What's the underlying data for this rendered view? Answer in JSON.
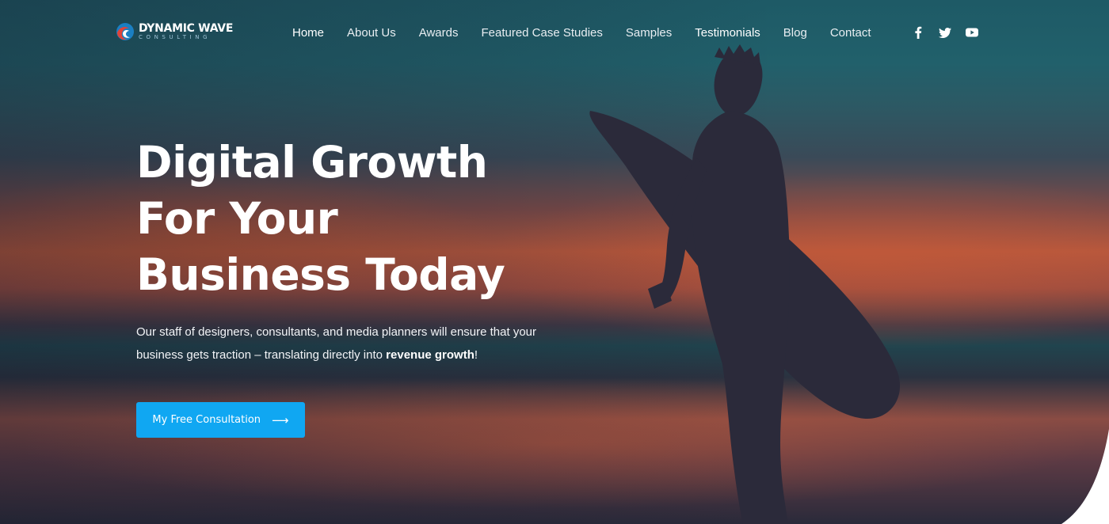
{
  "brand": {
    "name": "DYNAMIC WAVE",
    "tagline": "CONSULTING",
    "logo_icon": "wave-logo-icon",
    "colors": {
      "red": "#e0433a",
      "blue": "#1b7fc2",
      "white": "#ffffff"
    }
  },
  "nav": {
    "items": [
      {
        "label": "Home",
        "state": "active"
      },
      {
        "label": "About Us"
      },
      {
        "label": "Awards"
      },
      {
        "label": "Featured Case Studies"
      },
      {
        "label": "Samples"
      },
      {
        "label": "Testimonials"
      },
      {
        "label": "Blog"
      },
      {
        "label": "Contact"
      }
    ]
  },
  "social": {
    "icons": [
      "facebook-icon",
      "twitter-icon",
      "youtube-icon"
    ]
  },
  "hero": {
    "headline": [
      "Digital Growth",
      "For Your",
      "Business Today"
    ],
    "lead_text": "Our staff of designers, consultants, and media planners will ensure that your business gets traction – translating directly into ",
    "lead_emphasis": "revenue growth",
    "lead_end": "!",
    "cta_label": "My Free Consultation",
    "cta_icon": "arrow-right-icon"
  },
  "colors": {
    "accent": "#10a7f2",
    "text": "#ffffff",
    "sky_teal": "#1e5a66",
    "sunset_orange": "#b5573d"
  }
}
